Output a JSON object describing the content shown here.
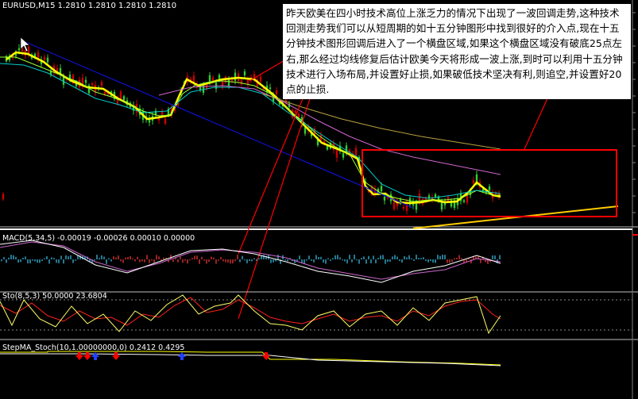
{
  "chart": {
    "symbol_line": "EURUSD,M15  1.2810 1.2810 1.2810 1.2810",
    "panels": {
      "macd": "MACD(5,34,5) -0.00019 -0.00026 0.00010 0.00000",
      "sto": "Sto(8,5,3) 50.0000 23.6804",
      "stepma": "StepMA_Stoch(10,1.00000000,0) 0.2412 0.4295"
    },
    "price_ticks": [
      "",
      "",
      "",
      "",
      "",
      "",
      "",
      "",
      "",
      "",
      "",
      "",
      ""
    ],
    "colors": {
      "background": "#000000",
      "bull_candle": "#33cc33",
      "bear_candle": "#cc0000",
      "price_line": "#ffff00",
      "annotation_box": "#ff0000",
      "trendline": "#0000cc",
      "support_line": "#ffcc00"
    }
  },
  "annotation": {
    "text": "昨天欧美在四小时技术高位上涨乏力的情况下出现了一波回调走势,这种技术回测走势我们可以从短周期的如十五分钟图形中找到很好的介入点,现在十五分钟技术图形回调后进入了一个横盘区域,如果这个横盘区域没有破底25点左右,那么经过均线修复后估计欧美今天将形成一波上涨,到时可以利用十五分钟技术进行入场布局,并设置好止损,如果破低技术坚决有利,则追空,并设置好20点的止损."
  }
}
